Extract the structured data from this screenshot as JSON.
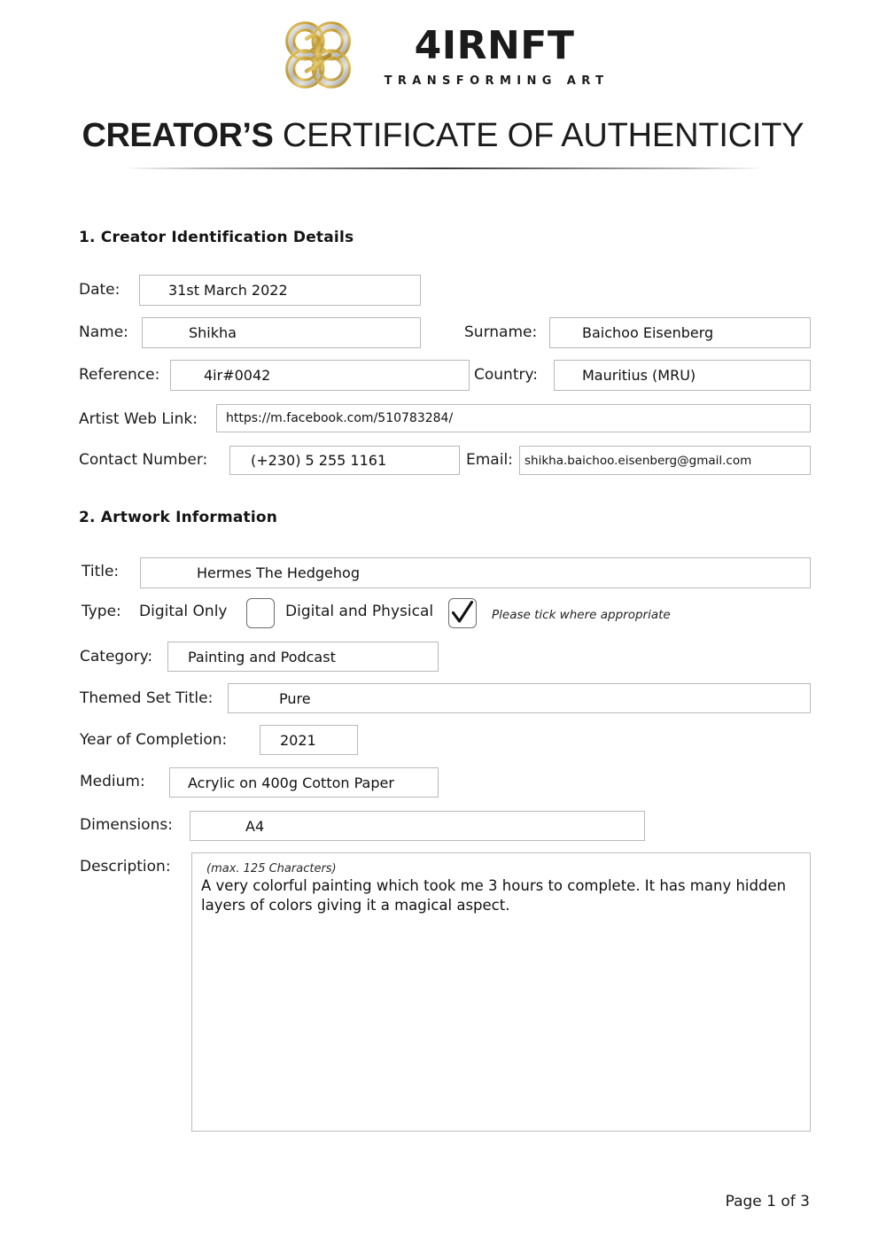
{
  "brand": {
    "logo_icon": "4irnft-quatrefoil-knot-logo",
    "name": "4IRNFT",
    "tagline": "TRANSFORMING ART",
    "gold": "#c9a227",
    "silver": "#c7c7c7"
  },
  "document": {
    "title_bold": "CREATOR’S",
    "title_rest": "CERTIFICATE OF AUTHENTICITY",
    "footer": "Page 1 of 3"
  },
  "section1": {
    "heading": "1. Creator Identification Details",
    "fields": {
      "date_label": "Date:",
      "date_value": "31st March 2022",
      "name_label": "Name:",
      "name_value": "Shikha",
      "surname_label": "Surname:",
      "surname_value": "Baichoo Eisenberg",
      "reference_label": "Reference:",
      "reference_value": "4ir#0042",
      "country_label": "Country:",
      "country_value": "Mauritius (MRU)",
      "weblink_label": "Artist Web Link:",
      "weblink_value": "https://m.facebook.com/510783284/",
      "contact_label": "Contact Number:",
      "contact_value": "(+230) 5 255 1161",
      "email_label": "Email:",
      "email_value": "shikha.baichoo.eisenberg@gmail.com"
    }
  },
  "section2": {
    "heading": "2. Artwork Information",
    "fields": {
      "title_label": "Title:",
      "title_value": "Hermes The Hedgehog",
      "type_label": "Type:",
      "type_option_1": "Digital Only",
      "type_option_2": "Digital and Physical",
      "type_hint": "Please tick where appropriate",
      "type_checked": "digital-and-physical",
      "category_label": "Category:",
      "category_value": "Painting and Podcast",
      "themed_set_label": "Themed Set Title:",
      "themed_set_value": "Pure",
      "year_label": "Year of Completion:",
      "year_value": "2021",
      "medium_label": "Medium:",
      "medium_value": "Acrylic on 400g Cotton Paper",
      "dimensions_label": "Dimensions:",
      "dimensions_value": "A4",
      "description_label": "Description:",
      "description_hint": "(max. 125 Characters)",
      "description_value": "A very colorful painting which took me 3 hours to complete. It has many hidden layers of colors giving it a magical aspect."
    }
  }
}
